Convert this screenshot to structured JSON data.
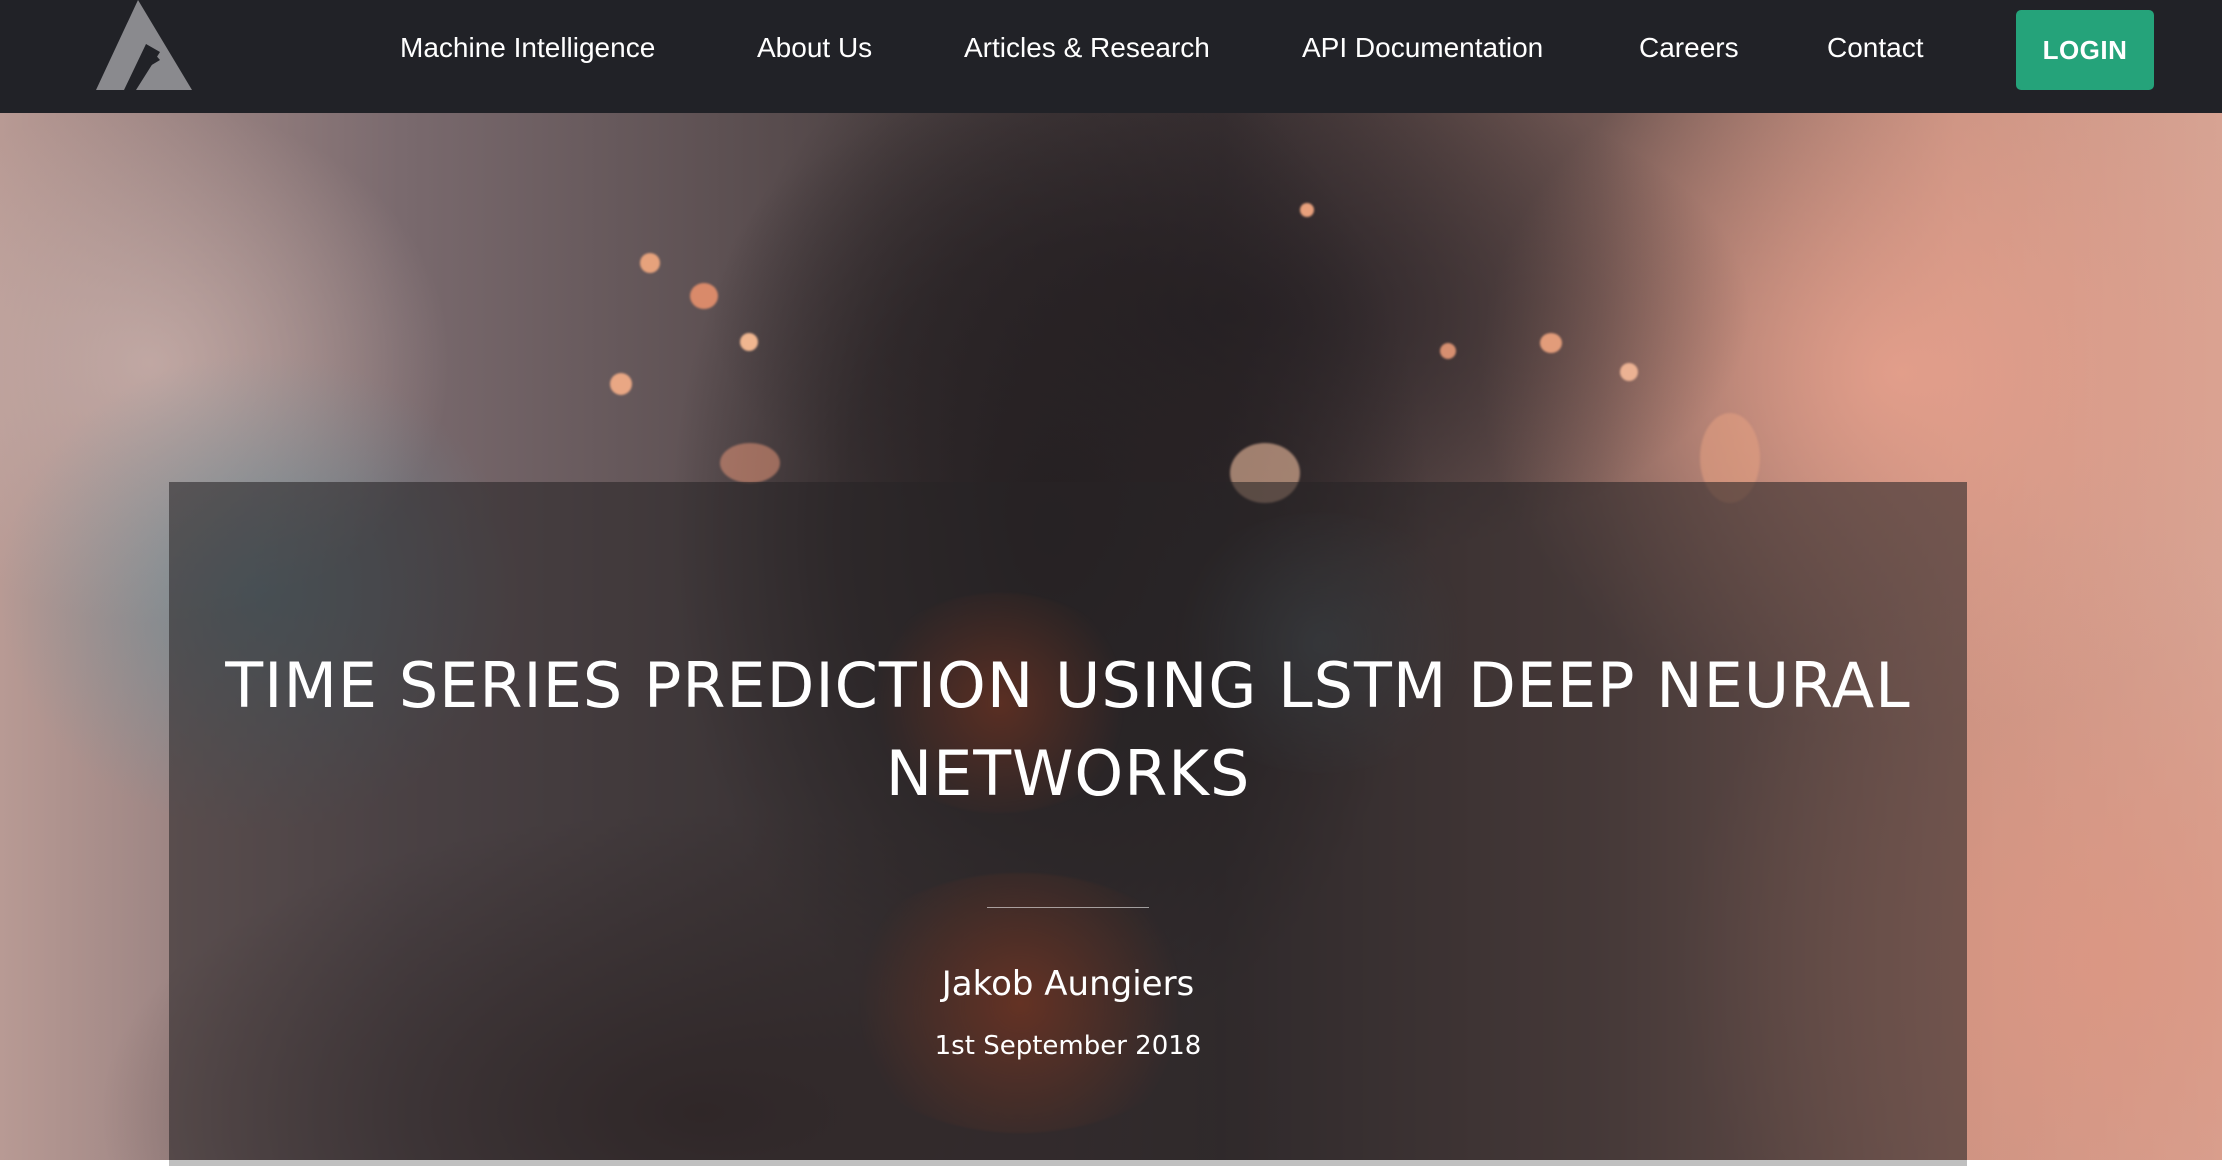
{
  "navbar": {
    "logo_name": "triangle-logo",
    "links": [
      "Machine Intelligence",
      "About Us",
      "Articles & Research",
      "API Documentation",
      "Careers",
      "Contact"
    ],
    "login_label": "LOGIN"
  },
  "hero": {
    "title": "TIME SERIES PREDICTION USING LSTM DEEP NEURAL NETWORKS",
    "author": "Jakob Aungiers",
    "date": "1st September 2018"
  },
  "colors": {
    "navbar_bg": "#212227",
    "login_bg": "#25a37a",
    "text": "#ffffff"
  }
}
